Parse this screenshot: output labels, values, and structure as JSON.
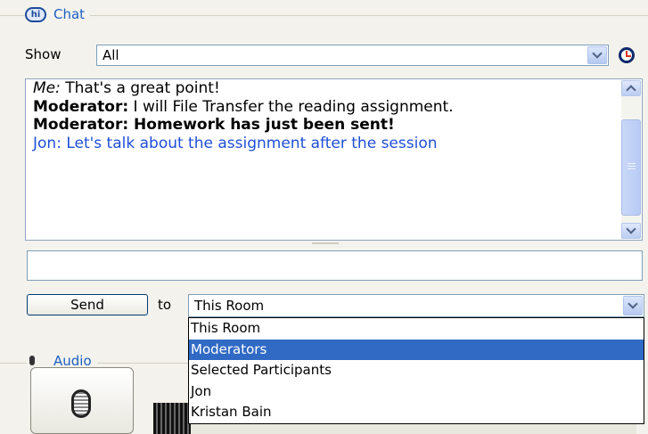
{
  "chat": {
    "header": "Chat",
    "show_label": "Show",
    "show_value": "All",
    "messages": [
      {
        "sender": "Me:",
        "text": " That's a great point!"
      },
      {
        "sender": "Moderator:",
        "text": " I will File Transfer the reading assignment."
      },
      {
        "text": "Moderator: Homework has just been sent!"
      },
      {
        "text": "Jon: Let's talk about the assignment after the session"
      }
    ],
    "message_input": "",
    "send_label": "Send",
    "to_label": "to",
    "to_value": "This Room",
    "to_options": [
      "This Room",
      "Moderators",
      "Selected Participants",
      "Jon",
      "Kristan Bain"
    ],
    "highlighted_option": "Moderators"
  },
  "audio": {
    "header": "Audio"
  },
  "colors": {
    "accent": "#1d5fc4",
    "selection": "#316ac5",
    "link_text": "#1f4fd8"
  }
}
